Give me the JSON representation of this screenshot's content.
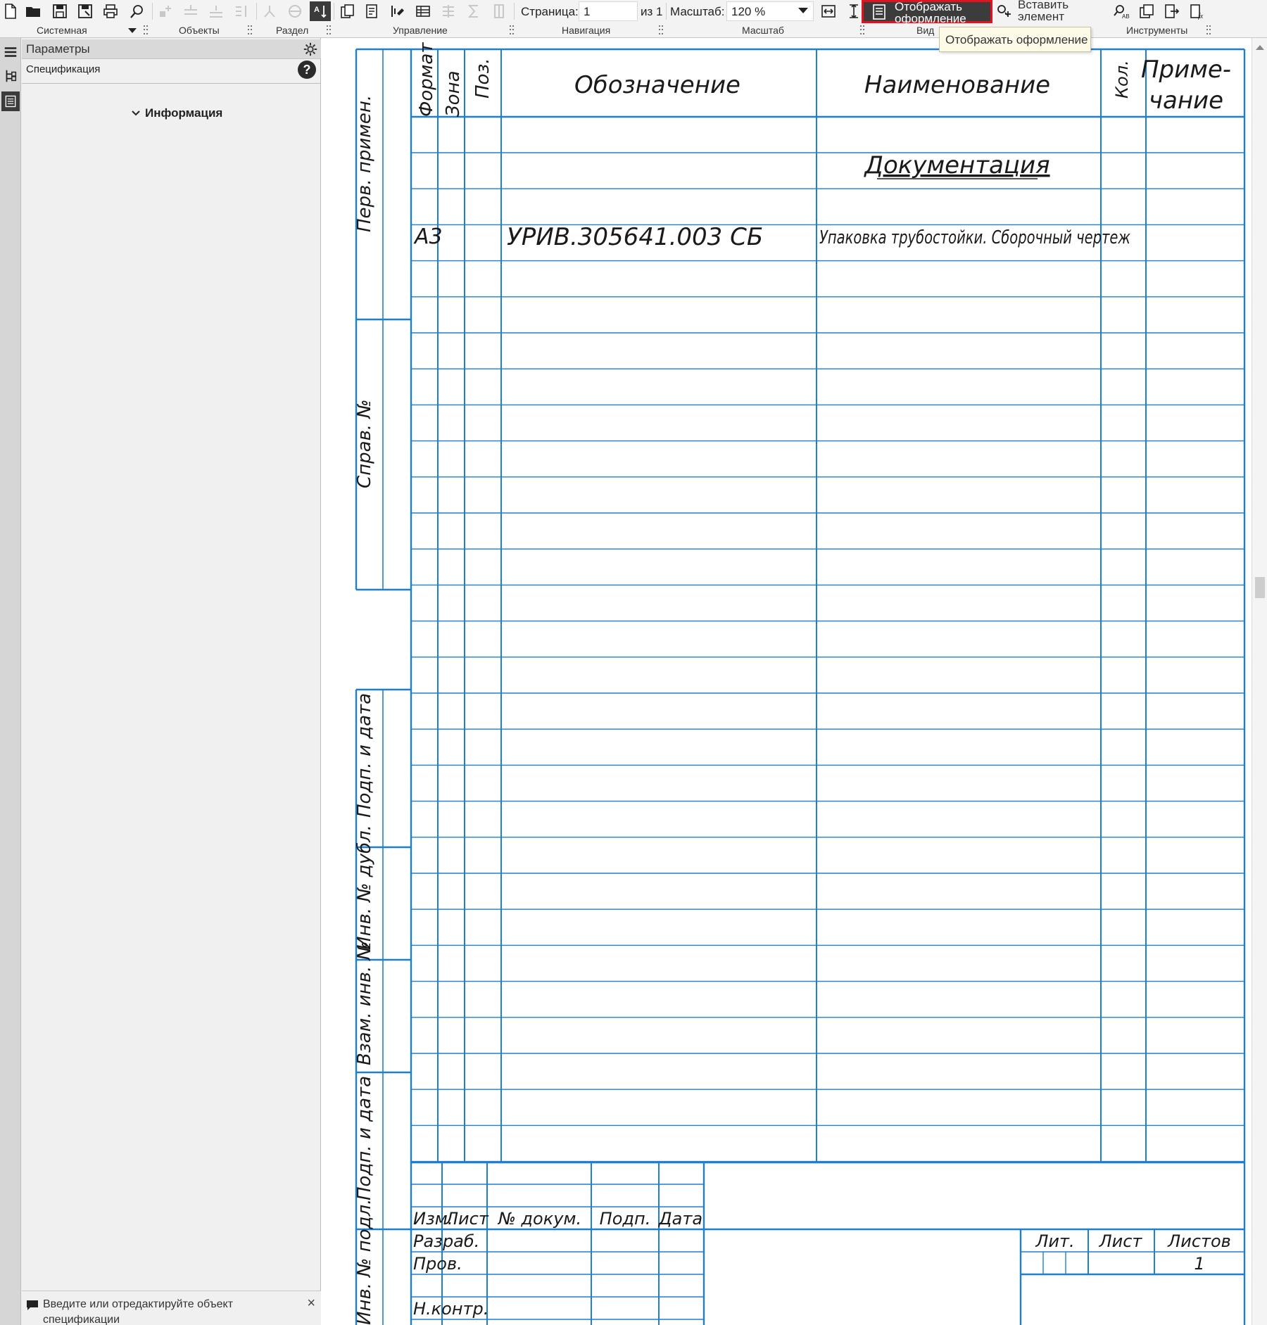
{
  "toolbar": {
    "groups": {
      "system": "Системная",
      "objects": "Объекты",
      "section": "Раздел",
      "control": "Управление",
      "navigation": "Навигация",
      "scale": "Масштаб",
      "view": "Вид",
      "tools": "Инструменты"
    },
    "page_label": "Страница:",
    "page_value": "1",
    "page_of": "из 1",
    "scale_label": "Масштаб:",
    "scale_value": "120 %",
    "display_button": "Отображать оформление",
    "insert_button": "Вставить элемент",
    "tooltip": "Отображать оформление",
    "accent_color": "#e0141e"
  },
  "params_panel": {
    "title": "Параметры",
    "subtitle": "Спецификация",
    "help": "?",
    "section": "Информация",
    "message": "Введите или отредактируйте объект спецификации",
    "close": "×"
  },
  "sheet": {
    "line_color": "#1e7fd1",
    "headers": {
      "format": "Формат",
      "zone": "Зона",
      "pos": "Поз.",
      "designation": "Обозначение",
      "name": "Наименование",
      "qty": "Кол.",
      "note_line1": "Приме-",
      "note_line2": "чание"
    },
    "rows": [
      {
        "format": "",
        "zone": "",
        "pos": "",
        "designation": "",
        "name": "",
        "qty": "",
        "note": ""
      },
      {
        "format": "",
        "zone": "",
        "pos": "",
        "designation": "",
        "name": "Документация",
        "qty": "",
        "note": "",
        "underline": true
      },
      {
        "format": "",
        "zone": "",
        "pos": "",
        "designation": "",
        "name": "",
        "qty": "",
        "note": ""
      },
      {
        "format": "А3",
        "zone": "",
        "pos": "",
        "designation": "УРИВ.305641.003 СБ",
        "name": "Упаковка трубостойки. Сборочный чертеж",
        "qty": "",
        "note": ""
      }
    ],
    "side_labels": {
      "perv_primen": "Перв. примен.",
      "sprav_no": "Справ. №",
      "podp_data_1": "Подп. и дата",
      "inv_dubl": "Инв. № дубл.",
      "vzam_inv": "Взам. инв. №",
      "podp_data_2": "Подп. и дата",
      "inv_podl": "Инв. № подл."
    },
    "stamp": {
      "izm": "Изм.",
      "list": "Лист",
      "doc_no": "№ докум.",
      "podp": "Подп.",
      "data": "Дата",
      "razrab": "Разраб.",
      "prov": "Пров.",
      "nkontr": "Н.контр.",
      "lit": "Лит.",
      "list_h": "Лист",
      "listov": "Листов",
      "listov_value": "1"
    }
  }
}
